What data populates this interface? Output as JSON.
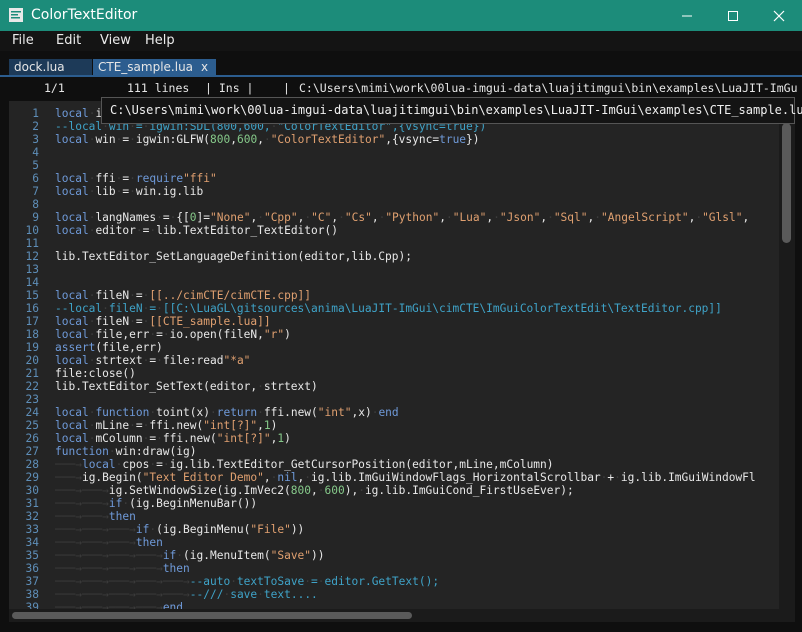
{
  "window": {
    "title": "ColorTextEditor",
    "accent": "#1c8c7a",
    "minimize_icon": "minimize-icon",
    "maximize_icon": "maximize-icon",
    "close_icon": "close-icon"
  },
  "menu": [
    "File",
    "Edit",
    "View",
    "Help"
  ],
  "tabs": [
    {
      "label": "dock.lua",
      "active": false
    },
    {
      "label": "CTE_sample.lua",
      "active": true,
      "close_icon": "x"
    }
  ],
  "status": {
    "position": "1/1",
    "lines": "111 lines",
    "mode": "| Ins |",
    "sep": "|",
    "path": "C:\\Users\\mimi\\work\\00lua-imgui-data\\luajitimgui\\bin\\examples\\LuaJIT-ImGu"
  },
  "tooltip": "C:\\Users\\mimi\\work\\00lua-imgui-data\\luajitimgui\\bin\\examples\\LuaJIT-ImGui\\examples\\CTE_sample.lua",
  "editor": {
    "lines": [
      {
        "n": "1",
        "t": "local i"
      },
      {
        "n": "2",
        "t": "--local win = igwin:SDL(800,600, \"ColorTextEditor\",{vsync=true})"
      },
      {
        "n": "3",
        "t": "local win = igwin:GLFW(800,600, \"ColorTextEditor\",{vsync=true})"
      },
      {
        "n": "4",
        "t": ""
      },
      {
        "n": "5",
        "t": ""
      },
      {
        "n": "6",
        "t": "local ffi = require\"ffi\""
      },
      {
        "n": "7",
        "t": "local lib = win.ig.lib"
      },
      {
        "n": "8",
        "t": ""
      },
      {
        "n": "9",
        "t": "local langNames = {[0]=\"None\", \"Cpp\", \"C\", \"Cs\", \"Python\", \"Lua\", \"Json\", \"Sql\", \"AngelScript\", \"Glsl\","
      },
      {
        "n": "10",
        "t": "local editor = lib.TextEditor_TextEditor()"
      },
      {
        "n": "11",
        "t": ""
      },
      {
        "n": "12",
        "t": "lib.TextEditor_SetLanguageDefinition(editor,lib.Cpp);"
      },
      {
        "n": "13",
        "t": ""
      },
      {
        "n": "14",
        "t": ""
      },
      {
        "n": "15",
        "t": "local fileN = [[../cimCTE/cimCTE.cpp]]"
      },
      {
        "n": "16",
        "t": "--local fileN = [[C:\\LuaGL\\gitsources\\anima\\LuaJIT-ImGui\\cimCTE\\ImGuiColorTextEdit\\TextEditor.cpp]]"
      },
      {
        "n": "17",
        "t": "local fileN = [[CTE_sample.lua]]"
      },
      {
        "n": "18",
        "t": "local file,err = io.open(fileN,\"r\")"
      },
      {
        "n": "19",
        "t": "assert(file,err)"
      },
      {
        "n": "20",
        "t": "local strtext = file:read\"*a\""
      },
      {
        "n": "21",
        "t": "file:close()"
      },
      {
        "n": "22",
        "t": "lib.TextEditor_SetText(editor, strtext)"
      },
      {
        "n": "23",
        "t": ""
      },
      {
        "n": "24",
        "t": "local function toint(x) return ffi.new(\"int\",x) end"
      },
      {
        "n": "25",
        "t": "local mLine = ffi.new(\"int[?]\",1)"
      },
      {
        "n": "26",
        "t": "local mColumn = ffi.new(\"int[?]\",1)"
      },
      {
        "n": "27",
        "t": "function win:draw(ig)"
      },
      {
        "n": "28",
        "t": "    local cpos = ig.lib.TextEditor_GetCursorPosition(editor,mLine,mColumn)"
      },
      {
        "n": "29",
        "t": "    ig.Begin(\"Text Editor Demo\", nil, ig.lib.ImGuiWindowFlags_HorizontalScrollbar + ig.lib.ImGuiWindowFl"
      },
      {
        "n": "30",
        "t": "        ig.SetWindowSize(ig.ImVec2(800, 600), ig.lib.ImGuiCond_FirstUseEver);"
      },
      {
        "n": "31",
        "t": "        if (ig.BeginMenuBar())"
      },
      {
        "n": "32",
        "t": "        then"
      },
      {
        "n": "33",
        "t": "            if (ig.BeginMenu(\"File\"))"
      },
      {
        "n": "34",
        "t": "            then"
      },
      {
        "n": "35",
        "t": "                if (ig.MenuItem(\"Save\"))"
      },
      {
        "n": "36",
        "t": "                then"
      },
      {
        "n": "37",
        "t": "                    --auto textToSave = editor.GetText();"
      },
      {
        "n": "38",
        "t": "                    --/// save text...."
      },
      {
        "n": "39",
        "t": "                end"
      }
    ]
  },
  "colors": {
    "background": "#242424",
    "keyword": "#6f9ad9",
    "string": "#e0a070",
    "number": "#86c98a",
    "comment": "#3fa3c8",
    "line_number": "#5e8eb8",
    "tab_active": "#2c5d8f",
    "tab_inactive": "#1d3a58"
  }
}
